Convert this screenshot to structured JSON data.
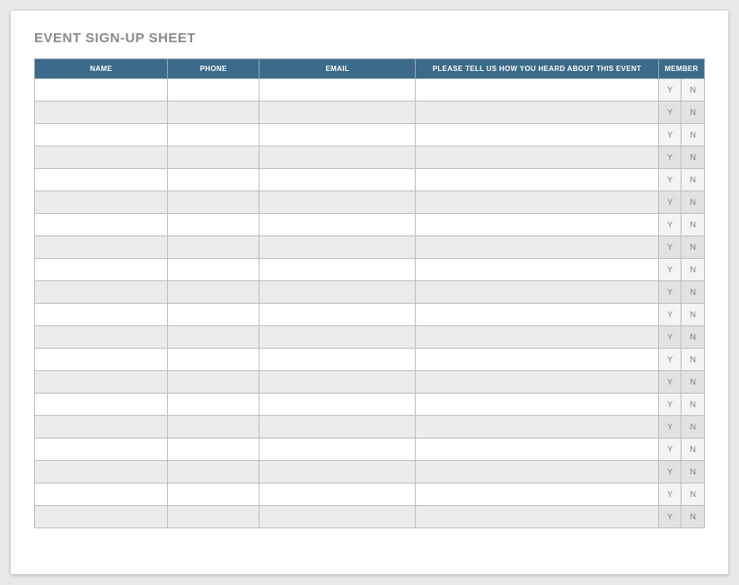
{
  "title": "EVENT SIGN-UP SHEET",
  "headers": {
    "name": "NAME",
    "phone": "PHONE",
    "email": "EMAIL",
    "heard": "PLEASE TELL US HOW YOU HEARD ABOUT THIS EVENT",
    "member": "MEMBER"
  },
  "member_options": {
    "yes": "Y",
    "no": "N"
  },
  "row_count": 20
}
